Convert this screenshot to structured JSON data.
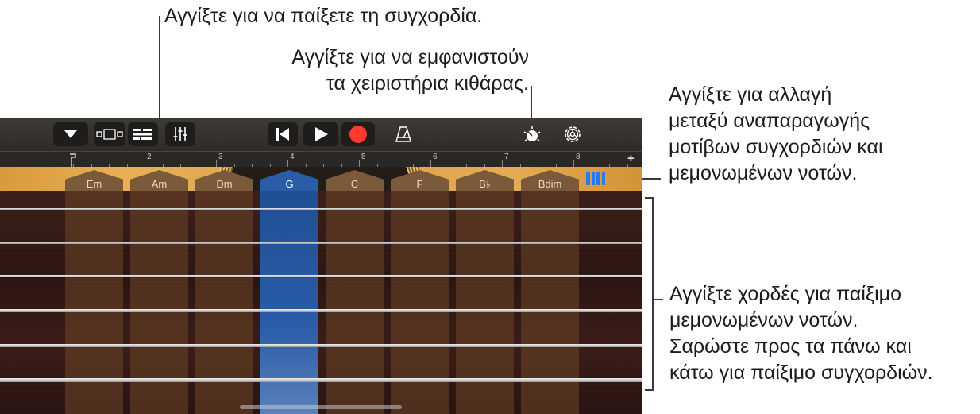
{
  "callouts": {
    "play_chord": "Αγγίξτε για να παίξετε τη συγχορδία.",
    "guitar_controls": [
      "Αγγίξτε για να εμφανιστούν",
      "τα χειριστήρια κιθάρας."
    ],
    "mode_switch": [
      "Αγγίξτε για αλλαγή",
      "μεταξύ αναπαραγωγής",
      "μοτίβων συγχορδιών και",
      "μεμονωμένων νοτών."
    ],
    "strings": [
      "Αγγίξτε χορδές για παίξιμο",
      "μεμονωμένων νοτών.",
      "Σαρώστε προς τα πάνω και",
      "κάτω για παίξιμο συγχορδιών."
    ]
  },
  "controlbar": {
    "icons": [
      "browser-dropdown-icon",
      "tracks-view-icon",
      "track-list-icon",
      "mixer-icon",
      "go-to-beginning-icon",
      "play-icon",
      "record-icon",
      "metronome-icon",
      "guitar-controls-icon",
      "settings-icon"
    ],
    "record_color": "#ff3b30"
  },
  "ruler": {
    "bars": [
      "2",
      "3",
      "4",
      "5",
      "6",
      "7",
      "8"
    ],
    "add": "+"
  },
  "chords": {
    "labels": [
      "Em",
      "Am",
      "Dm",
      "G",
      "C",
      "F",
      "B♭",
      "Bdim"
    ],
    "selected": "G",
    "selected_color": "#2a5ca8"
  },
  "mode_icon_color": "#1f7cf2"
}
